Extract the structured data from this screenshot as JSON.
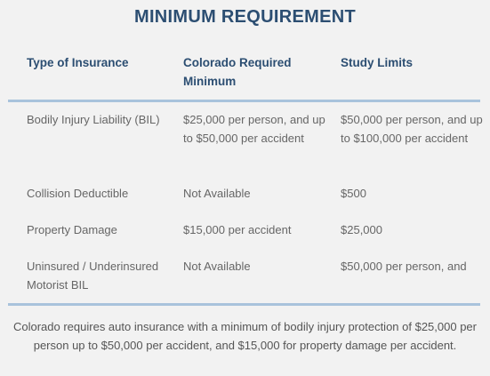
{
  "title": "MINIMUM REQUIREMENT",
  "table": {
    "headers": [
      "Type of Insurance",
      "Colorado Required Minimum",
      "Study Limits"
    ],
    "rows": [
      {
        "type": "Bodily Injury Liability (BIL)",
        "colorado": "$25,000 per person, and up to $50,000 per accident",
        "study": "$50,000 per person, and up to $100,000 per accident"
      },
      {
        "type": "Collision Deductible",
        "colorado": "Not Available",
        "study": "$500"
      },
      {
        "type": "Property Damage",
        "colorado": "$15,000 per accident",
        "study": "$25,000"
      },
      {
        "type": "Uninsured / Underinsured Motorist BIL",
        "colorado": "Not Available",
        "study": "$50,000 per person, and"
      }
    ]
  },
  "footnote": "Colorado requires auto insurance with a minimum of bodily injury protection of $25,000 per person up to $50,000 per accident, and $15,000 for property damage per accident."
}
